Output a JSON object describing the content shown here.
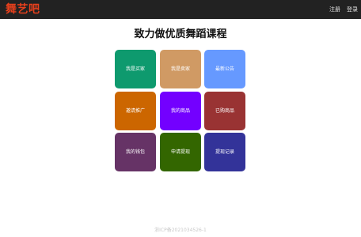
{
  "header": {
    "brand": "舞艺吧",
    "brand_color": "#e8401c",
    "register_label": "注册",
    "login_label": "登录"
  },
  "main": {
    "title": "致力做优质舞蹈课程",
    "tiles": [
      {
        "label": "我是买家",
        "color": "#0e9a6e"
      },
      {
        "label": "我是卖家",
        "color": "#d09a64"
      },
      {
        "label": "最新公告",
        "color": "#6699ff"
      },
      {
        "label": "邀请推广",
        "color": "#cc6600"
      },
      {
        "label": "我的商品",
        "color": "#7300ff"
      },
      {
        "label": "已购商品",
        "color": "#993333"
      },
      {
        "label": "我的钱包",
        "color": "#663366"
      },
      {
        "label": "申请提现",
        "color": "#336600"
      },
      {
        "label": "提现记录",
        "color": "#333399"
      }
    ]
  },
  "footer": {
    "text": "浙ICP备2021034526-1",
    "color": "#c8c8c8"
  }
}
